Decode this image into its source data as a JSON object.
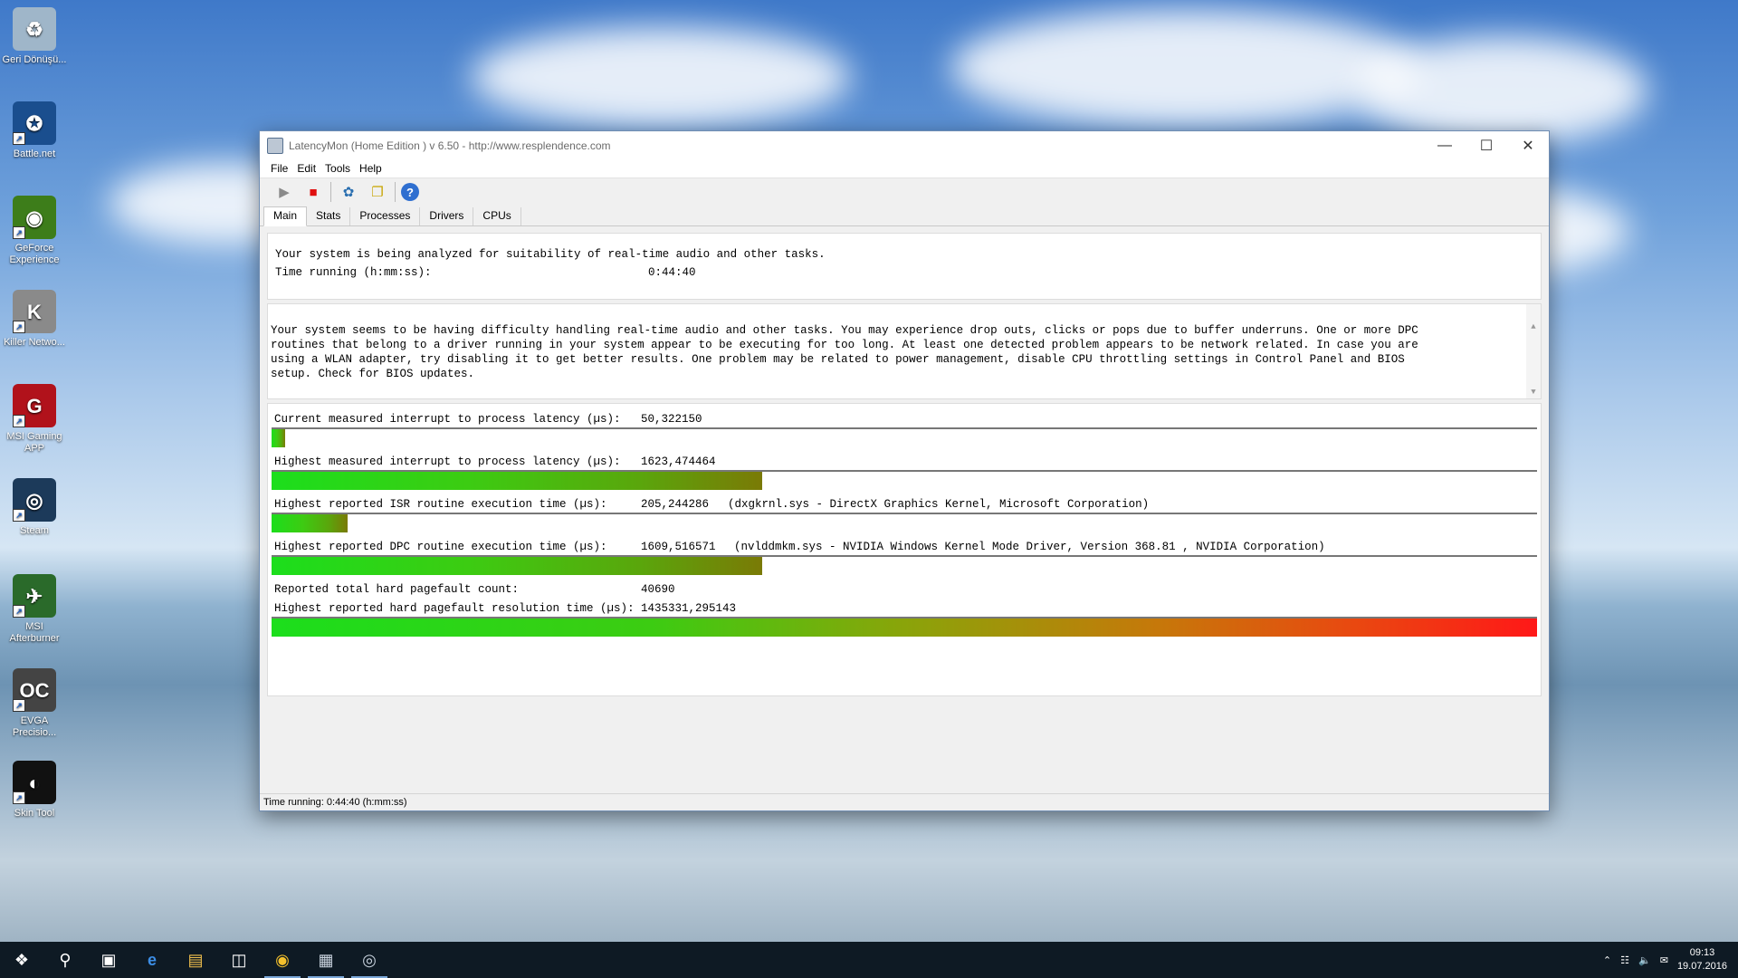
{
  "desktop": {
    "icons": [
      {
        "label": "Geri Dönüşü...",
        "glyph": "♻",
        "color": "#9fb6c9"
      },
      {
        "label": "Battle.net",
        "glyph": "✪",
        "color": "#1a4e8e"
      },
      {
        "label": "GeForce Experience",
        "glyph": "◉",
        "color": "#3d7d1a"
      },
      {
        "label": "Killer Netwo...",
        "glyph": "K",
        "color": "#8a8a8a"
      },
      {
        "label": "MSI Gaming APP",
        "glyph": "G",
        "color": "#b1121b"
      },
      {
        "label": "Steam",
        "glyph": "◎",
        "color": "#1c3a5a"
      },
      {
        "label": "MSI Afterburner",
        "glyph": "✈",
        "color": "#2a6a2a"
      },
      {
        "label": "EVGA Precisio...",
        "glyph": "OC",
        "color": "#444444"
      },
      {
        "label": "Skin Tool",
        "glyph": "◐",
        "color": "#111111"
      }
    ]
  },
  "window": {
    "title": "LatencyMon  (Home Edition )  v 6.50 - http://www.resplendence.com",
    "menu": [
      "File",
      "Edit",
      "Tools",
      "Help"
    ],
    "tabs": [
      "Main",
      "Stats",
      "Processes",
      "Drivers",
      "CPUs"
    ],
    "active_tab": "Main",
    "summary": {
      "line1": "Your system is being analyzed for suitability of real-time audio and other tasks.",
      "time_label": "Time running (h:mm:ss):",
      "time_value": "0:44:40"
    },
    "message": [
      "Your system seems to be having difficulty handling real-time audio and other tasks. You may experience drop outs, clicks or pops due to buffer underruns. One or more DPC",
      "routines that belong to a driver running in your system appear to be executing for too long. At least one detected problem appears to be network related. In case you are",
      "using a WLAN adapter, try disabling it to get better results. One problem may be related to power management, disable CPU throttling settings in Control Panel and BIOS",
      "setup. Check for BIOS updates."
    ],
    "metrics": [
      {
        "label": "Current measured interrupt to process latency (µs):",
        "value": "50,322150",
        "detail": "",
        "level": 0.011,
        "full": false
      },
      {
        "label": "Highest measured interrupt to process latency (µs):",
        "value": "1623,474464",
        "detail": "",
        "level": 0.388,
        "full": false
      },
      {
        "label": "Highest reported ISR routine execution time (µs):",
        "value": "205,244286",
        "detail": "(dxgkrnl.sys - DirectX Graphics Kernel, Microsoft Corporation)",
        "level": 0.06,
        "full": false
      },
      {
        "label": "Highest reported DPC routine execution time (µs):",
        "value": "1609,516571",
        "detail": "(nvlddmkm.sys - NVIDIA Windows Kernel Mode Driver, Version 368.81 , NVIDIA Corporation)",
        "level": 0.388,
        "full": false
      }
    ],
    "pagefault": {
      "count_label": "Reported total hard pagefault count:",
      "count_value": "40690",
      "time_label": "Highest reported hard pagefault resolution time (µs):",
      "time_value": "1435331,295143",
      "level": 1.0
    },
    "status_text": "Time running: 0:44:40  (h:mm:ss)"
  },
  "taskbar": {
    "clock_time": "09:13",
    "clock_date": "19.07.2016"
  }
}
